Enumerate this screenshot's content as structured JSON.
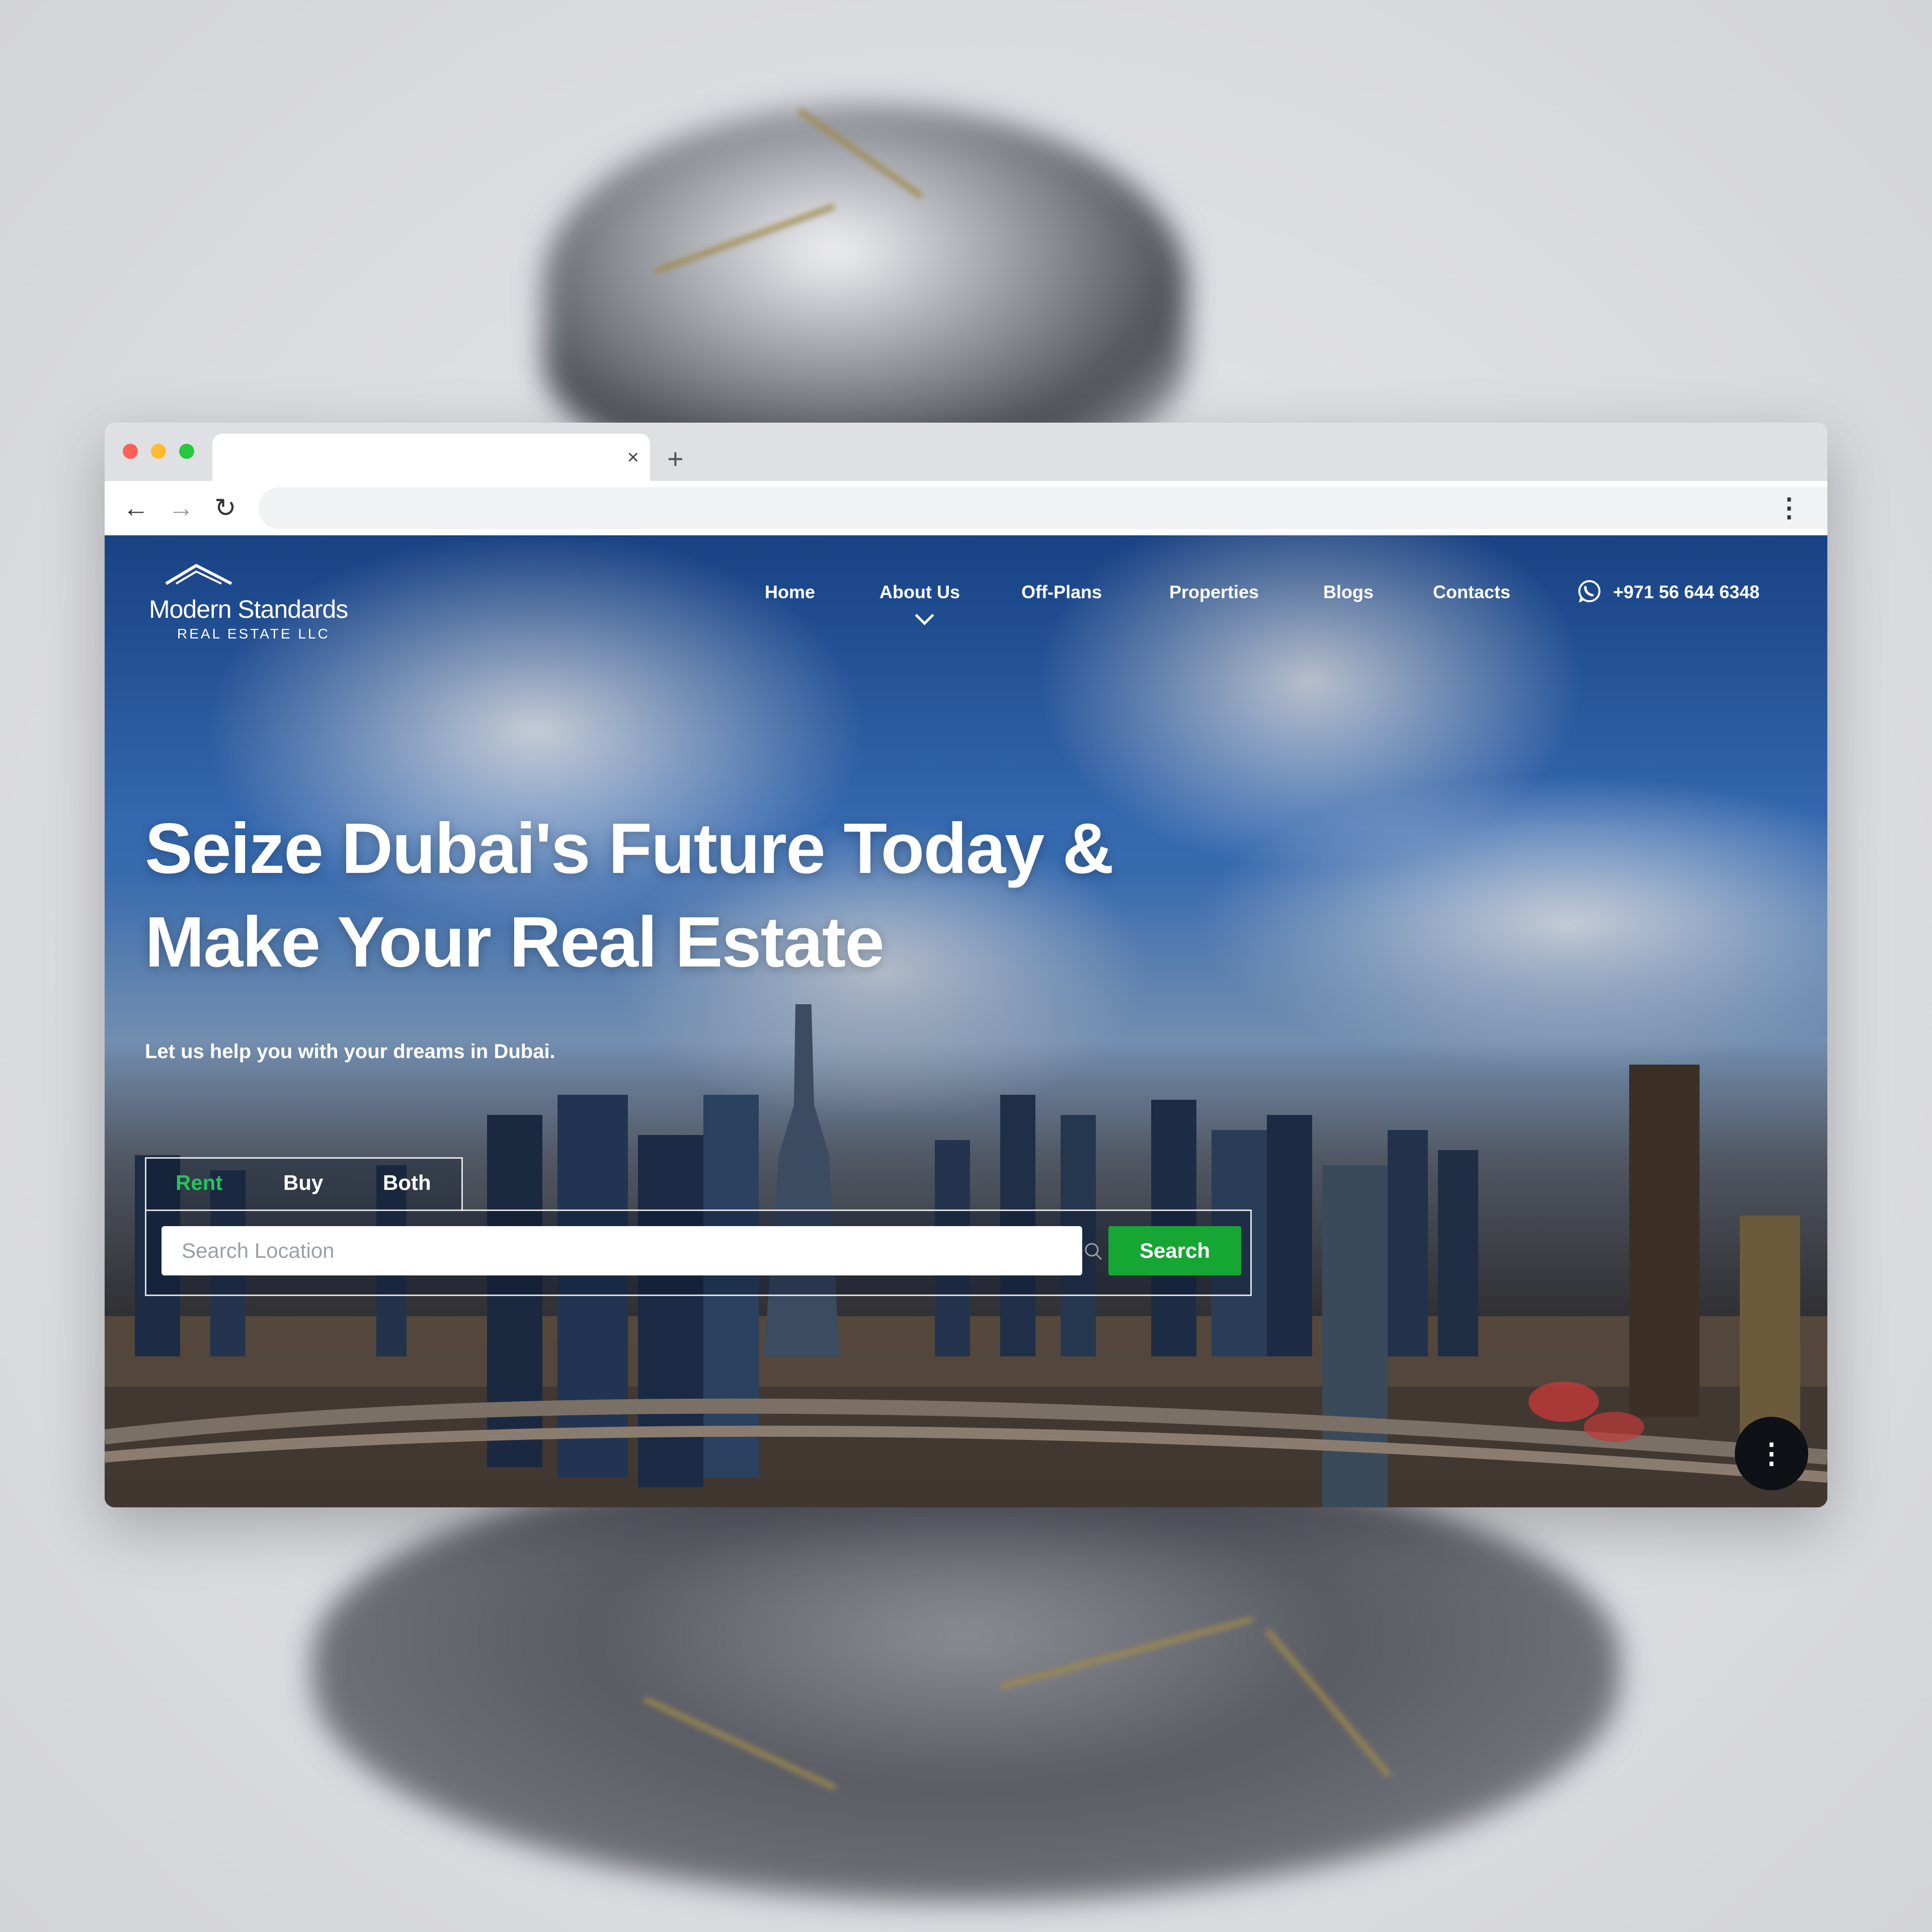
{
  "browser": {
    "tab_close": "×",
    "new_tab": "+",
    "back_icon": "←",
    "forward_icon": "→",
    "reload_icon": "↻",
    "menu_icon": "⋮"
  },
  "site": {
    "logo": {
      "mark": "MS",
      "name": "Modern Standards",
      "sub": "REAL ESTATE LLC"
    },
    "nav": {
      "home": "Home",
      "about": "About Us",
      "offplans": "Off-Plans",
      "properties": "Properties",
      "blogs": "Blogs",
      "contacts": "Contacts",
      "phone": "+971 56 644 6348"
    },
    "hero": {
      "headline_line1": "Seize Dubai's Future Today &",
      "headline_line2": "Make Your Real Estate",
      "subline": "Let us help you with your dreams in Dubai."
    },
    "search": {
      "tabs": [
        "Rent",
        "Buy",
        "Both"
      ],
      "active_tab": "Rent",
      "placeholder": "Search Location",
      "button": "Search"
    },
    "fab_icon": "⋮"
  },
  "colors": {
    "accent_green": "#16a634",
    "active_tab_green": "#22c55e"
  },
  "icons": {
    "whatsapp": "whatsapp-icon",
    "search": "search-icon",
    "chevron": "chevron-down-icon"
  }
}
